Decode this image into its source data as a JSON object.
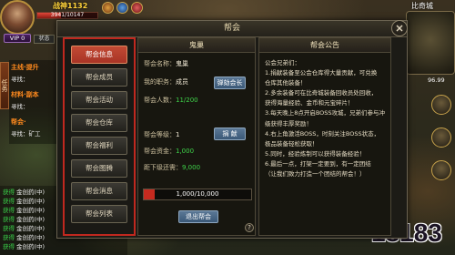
{
  "hud": {
    "player": {
      "name": "战神1132",
      "vip": "VIP 0",
      "status": "状态",
      "hp_text": "3941/10147",
      "hp_fraction": 0.39
    },
    "map": {
      "name": "比奇城",
      "coords": "96.99"
    },
    "icons": [
      "player-avatar",
      "buff-icon",
      "minimap",
      "hud-button-icon"
    ]
  },
  "quests": {
    "tab": "任务",
    "items": [
      {
        "title": "主线·提升",
        "desc": "寻找："
      },
      {
        "title": "材料·副本",
        "desc": "寻找："
      },
      {
        "title": "帮会·",
        "desc": "寻找：矿工"
      }
    ]
  },
  "chat": {
    "lines": [
      {
        "tag": "获得",
        "text": "金创药(中)"
      },
      {
        "tag": "获得",
        "text": "金创药(中)"
      },
      {
        "tag": "获得",
        "text": "金创药(中)"
      },
      {
        "tag": "获得",
        "text": "金创药(中)"
      },
      {
        "tag": "获得",
        "text": "金创药(中)"
      },
      {
        "tag": "获得",
        "text": "金创药(中)"
      },
      {
        "tag": "获得",
        "text": "金创药(中)"
      }
    ]
  },
  "guild": {
    "title": "帮会",
    "close_icon": "close-icon",
    "nav": [
      {
        "label": "帮会信息",
        "selected": true
      },
      {
        "label": "帮会成员",
        "selected": false
      },
      {
        "label": "帮会活动",
        "selected": false
      },
      {
        "label": "帮会仓库",
        "selected": false
      },
      {
        "label": "帮会福利",
        "selected": false
      },
      {
        "label": "帮会图腾",
        "selected": false
      },
      {
        "label": "帮会消息",
        "selected": false
      },
      {
        "label": "帮会列表",
        "selected": false
      }
    ],
    "info": {
      "header": "鬼巢",
      "name_label": "帮会名称：",
      "name_value": "鬼巢",
      "role_label": "我的职务：",
      "role_value": "成员",
      "impeach_button": "弹劾会长",
      "members_label": "帮会人数：",
      "members_value": "11/200",
      "level_label": "帮会等级：",
      "level_value": "1",
      "donate_button": "捐 献",
      "funds_label": "帮会资金：",
      "funds_value": "1,000",
      "next_label": "距下级还需：",
      "next_value": "9,000",
      "progress_text": "1,000/10,000",
      "progress_fraction": 0.1,
      "quit_button": "退出帮会",
      "help_icon": "help-icon"
    },
    "notice": {
      "header": "帮会公告",
      "lines": [
        "公会兄弟们：",
        "1.捐献装备至公会仓库得大量贡献，可兑换",
        "仓库其他装备！",
        "2.多余装备可在比奇城装备回收员处回收，",
        "获得海量经验、金币和元宝碎片！",
        "3.每天晚上8点开启BOSS攻城，兄弟们参与冲",
        "级获得丰厚奖励！",
        "4.右上角激活BOSS，时刻关注BOSS状态，",
        "极品装备轻松获取！",
        "5.同时，经验炼制可以获得装备经验！",
        "6.最后一点，打架一定要到，有一定团结",
        "（让我们致力打造一个团结的帮会！）"
      ]
    }
  },
  "watermark": "18183",
  "colors": {
    "selected_tab": "#a83426",
    "highlight_border": "#c0281f",
    "green_value": "#3fd34a",
    "button_blue": "#3a5877",
    "progress_fill": "#c62a1f"
  }
}
